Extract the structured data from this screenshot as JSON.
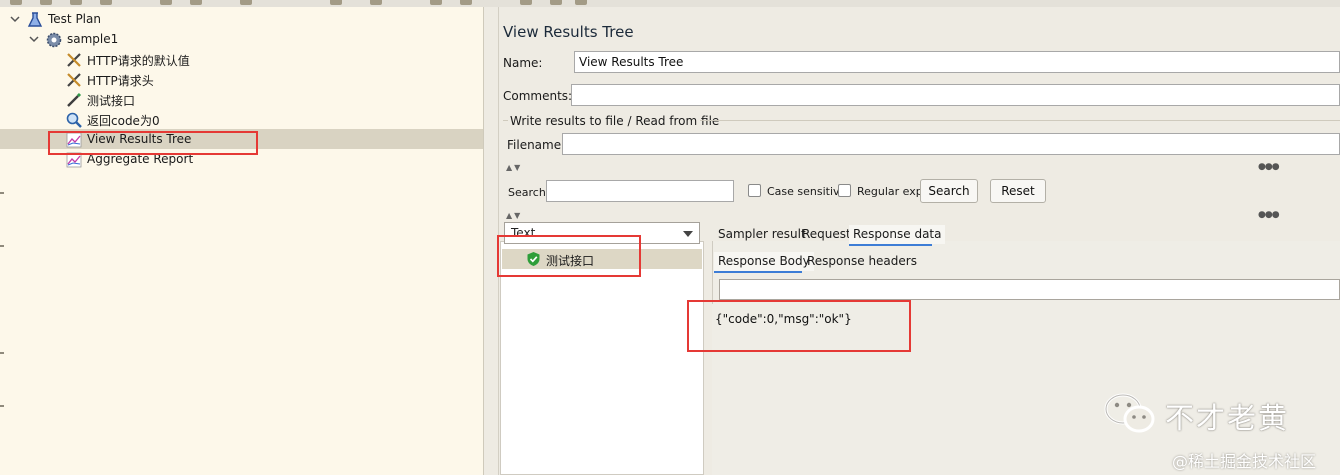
{
  "tree": {
    "items": [
      {
        "label": "Test Plan",
        "icon": "beaker-icon"
      },
      {
        "label": "sample1",
        "icon": "gear-icon"
      },
      {
        "label": "HTTP请求的默认值",
        "icon": "wrench-icon"
      },
      {
        "label": "HTTP请求头",
        "icon": "wrench-icon"
      },
      {
        "label": "测试接口",
        "icon": "pipette-icon"
      },
      {
        "label": "返回code为0",
        "icon": "magnifier-icon"
      },
      {
        "label": "View Results Tree",
        "icon": "chart-icon"
      },
      {
        "label": "Aggregate Report",
        "icon": "chart-icon"
      }
    ],
    "selected": "View Results Tree"
  },
  "panel": {
    "title": "View Results Tree",
    "name_label": "Name:",
    "name_value": "View Results Tree",
    "comments_label": "Comments:",
    "comments_value": "",
    "file_section_legend": "Write results to file / Read from file",
    "filename_label": "Filename",
    "filename_value": ""
  },
  "search": {
    "label": "Search:",
    "value": "",
    "case_sensitive_label": "Case sensitive",
    "regex_label": "Regular exp.",
    "search_button": "Search",
    "reset_button": "Reset"
  },
  "results": {
    "renderer": "Text",
    "samples": [
      {
        "label": "测试接口",
        "status": "success"
      }
    ]
  },
  "detail": {
    "tabs": [
      "Sampler result",
      "Request",
      "Response data"
    ],
    "active_tab": "Response data",
    "subtabs": [
      "Response Body",
      "Response headers"
    ],
    "active_subtab": "Response Body",
    "response_text": "{\"code\":0,\"msg\":\"ok\"}"
  },
  "watermark": {
    "author": "不才老黄",
    "site": "@稀土掘金技术社区"
  },
  "colors": {
    "tree_background": "#fdf8ea",
    "selection": "#d9d3c2",
    "annotation_red": "#e53935",
    "tab_accent": "#3d7dd6",
    "success_green": "#2e9e3a"
  }
}
